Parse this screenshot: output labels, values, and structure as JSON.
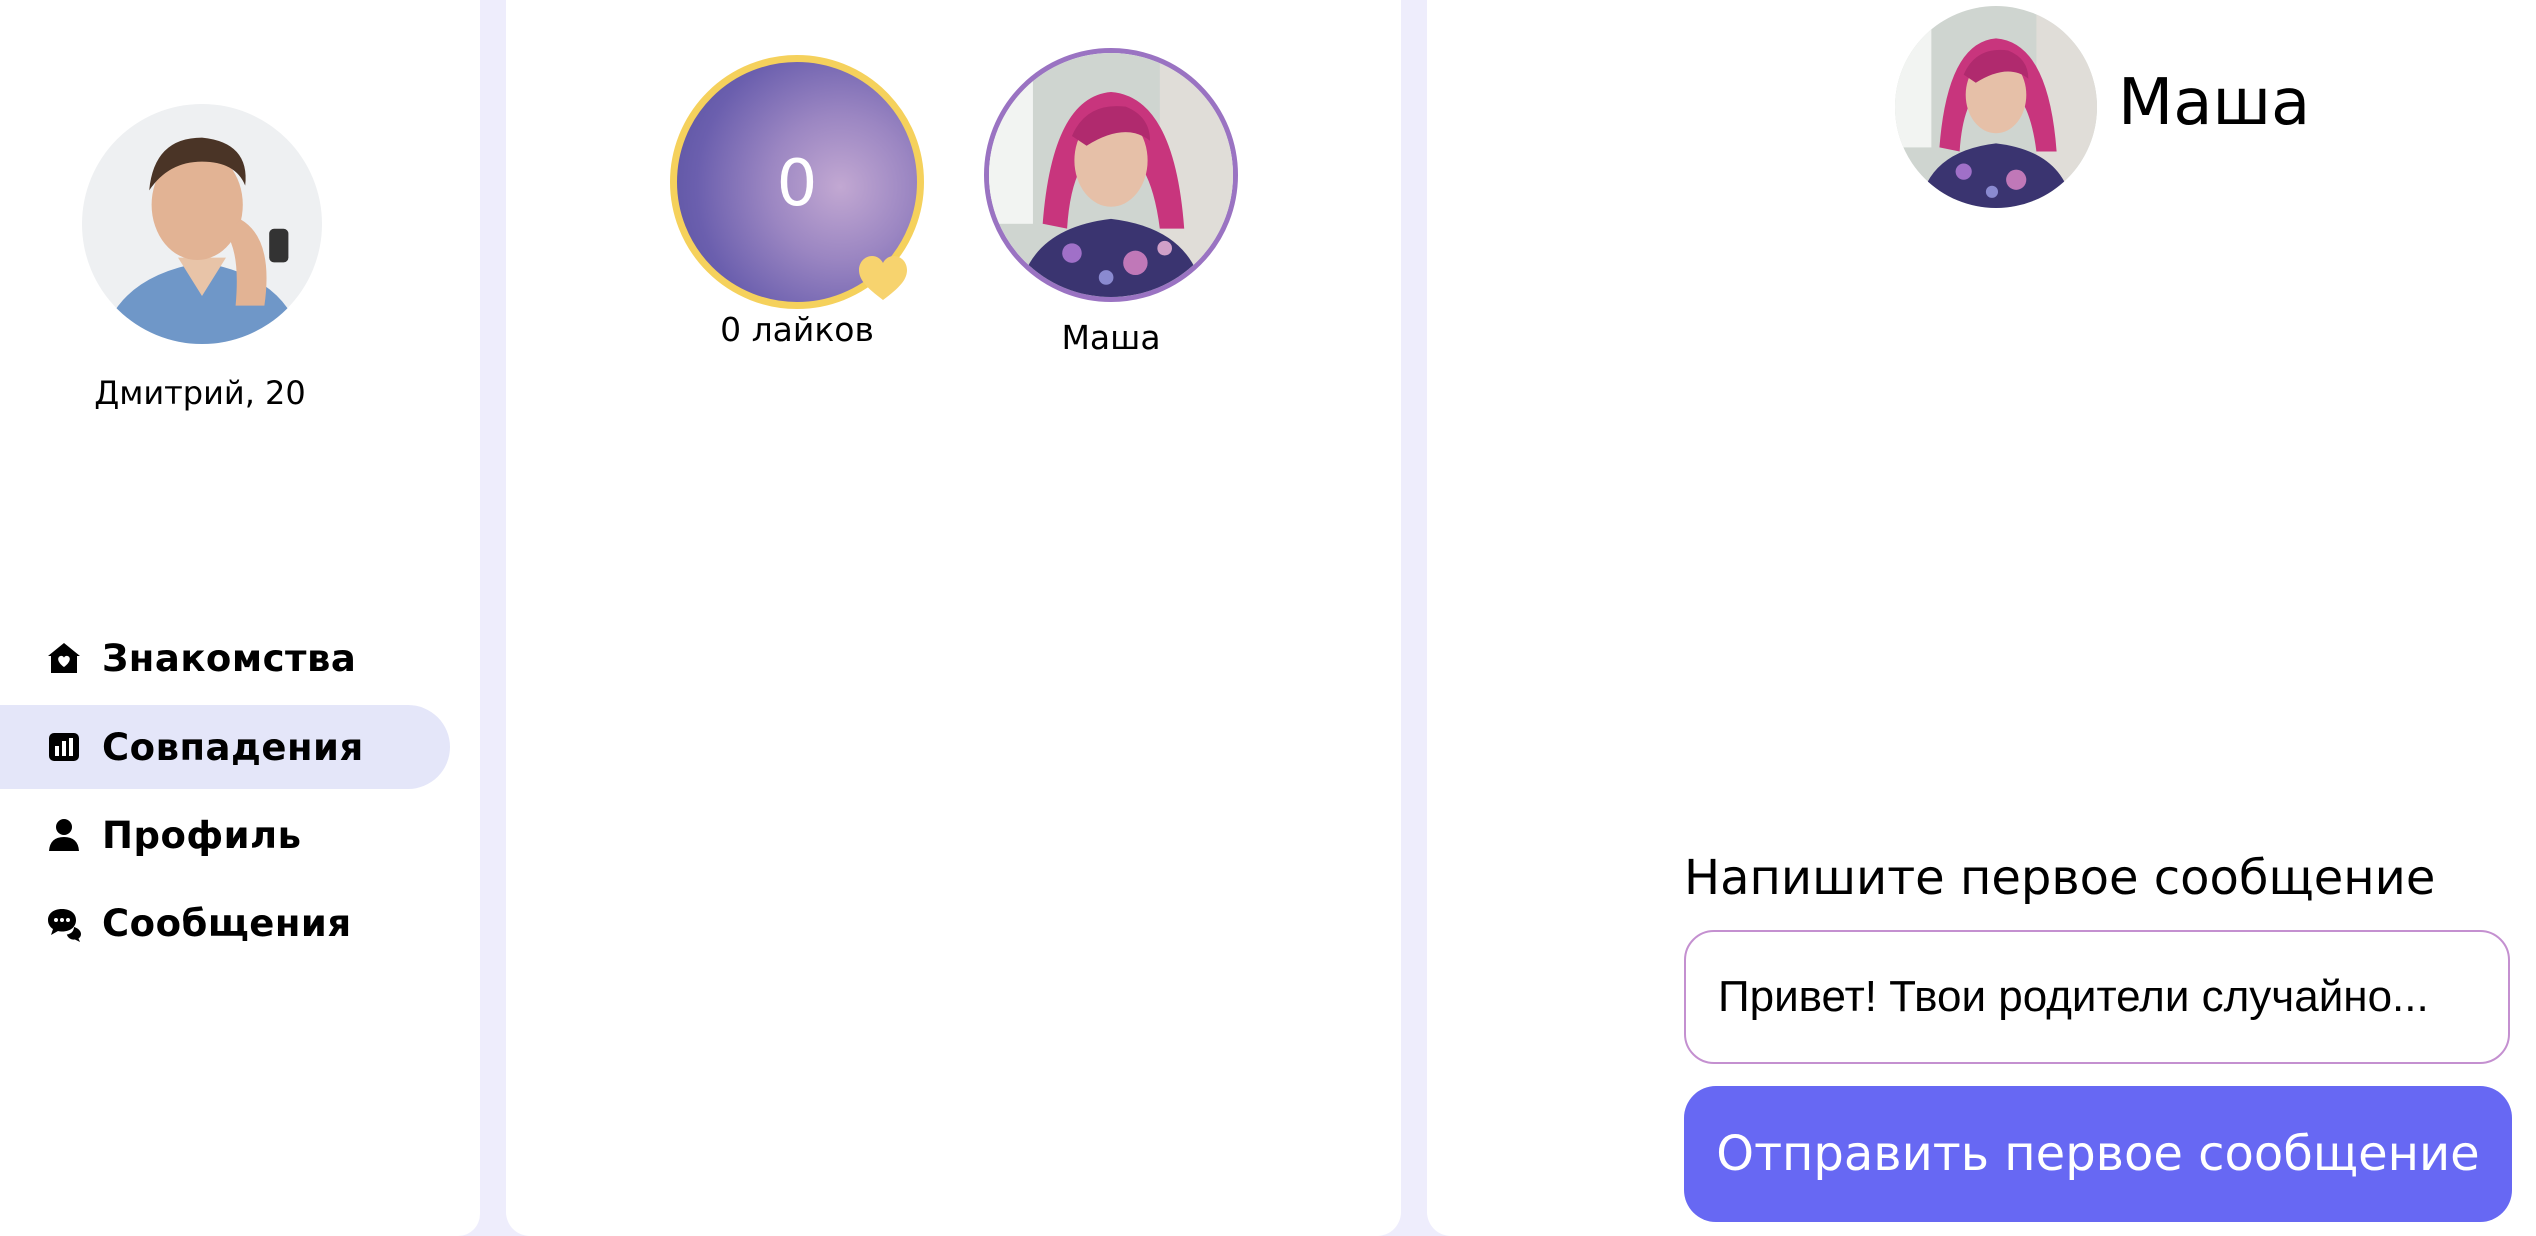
{
  "user": {
    "name_age": "Дмитрий, 20"
  },
  "nav": [
    {
      "label": "Знакомства",
      "icon": "home-heart-icon",
      "active": false
    },
    {
      "label": "Совпадения",
      "icon": "bar-chart-icon",
      "active": true
    },
    {
      "label": "Профиль",
      "icon": "person-icon",
      "active": false
    },
    {
      "label": "Сообщения",
      "icon": "chat-bubbles-icon",
      "active": false
    }
  ],
  "likes": {
    "count": "0",
    "label": "0 лайков",
    "icon": "heart-icon"
  },
  "matches": [
    {
      "name": "Маша"
    }
  ],
  "chat": {
    "partner_name": "Маша",
    "prompt_title": "Напишите первое сообщение",
    "input_value": "Привет! Твои родители случайно...",
    "send_label": "Отправить первое сообщение"
  },
  "colors": {
    "accent": "#6768f3",
    "active_nav_bg": "#e4e6f9",
    "page_bg": "#eeedfc",
    "likes_ring": "#f5d15c",
    "match_ring": "#9a73c2"
  }
}
